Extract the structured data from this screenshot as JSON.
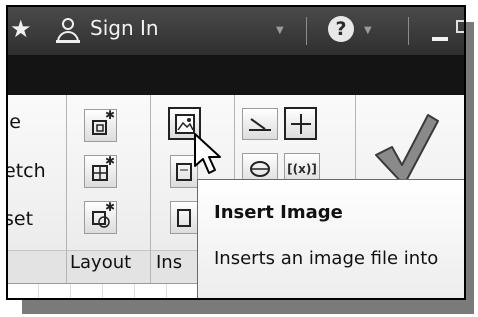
{
  "titlebar": {
    "signin_label": "Sign In",
    "help_glyph": "?",
    "star_glyph": "★",
    "icons": [
      "star-icon",
      "user-icon",
      "dropdown-arrow-icon",
      "help-icon",
      "minimize-icon",
      "restore-icon"
    ]
  },
  "ribbon": {
    "left_partial_items": [
      "le",
      "etch",
      "set"
    ],
    "panels": [
      {
        "title": "Layout"
      },
      {
        "title": "Ins"
      }
    ]
  },
  "tooltip": {
    "title": "Insert Image",
    "description": "Inserts an image file into"
  },
  "colors": {
    "titlebar": "#3a3a3a",
    "tabbar": "#141414",
    "ribbon": "#f2f2f2",
    "check": "#8a8a8a"
  }
}
